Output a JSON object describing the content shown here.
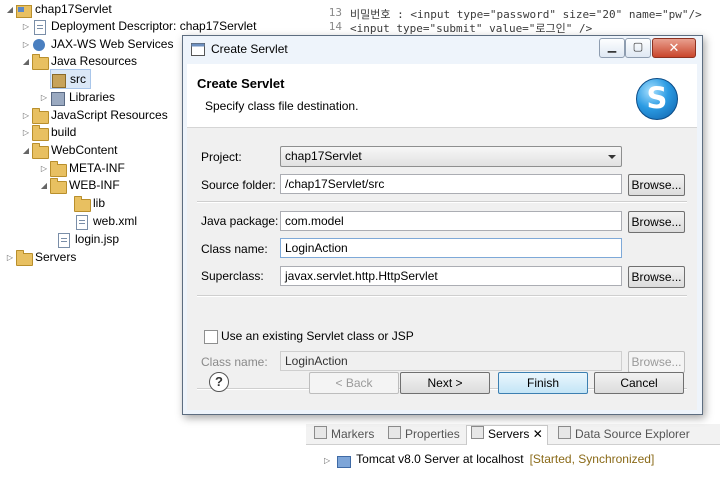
{
  "tree": {
    "items": [
      {
        "label": "chap17Servlet"
      },
      {
        "label": "Deployment Descriptor: chap17Servlet"
      },
      {
        "label": "JAX-WS Web Services"
      },
      {
        "label": "Java Resources"
      },
      {
        "label": "src"
      },
      {
        "label": "Libraries"
      },
      {
        "label": "JavaScript Resources"
      },
      {
        "label": "build"
      },
      {
        "label": "WebContent"
      },
      {
        "label": "META-INF"
      },
      {
        "label": "WEB-INF"
      },
      {
        "label": "lib"
      },
      {
        "label": "web.xml"
      },
      {
        "label": "login.jsp"
      },
      {
        "label": "Servers"
      }
    ]
  },
  "editor": {
    "lines": [
      {
        "num": "13",
        "text": "비밀번호 : <input type=\"password\" size=\"20\" name=\"pw\"/>"
      },
      {
        "num": "14",
        "text": "<input type=\"submit\" value=\"로그인\" />"
      }
    ]
  },
  "views": {
    "tabs": [
      "Markers",
      "Properties",
      "Servers",
      "Data Source Explorer"
    ],
    "server": {
      "name": "Tomcat v8.0 Server at localhost",
      "status": "[Started, Synchronized]"
    }
  },
  "dialog": {
    "window_title": "Create Servlet",
    "header_title": "Create Servlet",
    "header_desc": "Specify class file destination.",
    "logo_letter": "S",
    "project_label": "Project:",
    "project_value": "chap17Servlet",
    "source_folder_label": "Source folder:",
    "source_folder_value": "/chap17Servlet/src",
    "java_package_label": "Java package:",
    "java_package_value": "com.model",
    "class_name_label": "Class name:",
    "class_name_value": "LoginAction",
    "superclass_label": "Superclass:",
    "superclass_value": "javax.servlet.http.HttpServlet",
    "use_existing_label": "Use an existing Servlet class or JSP",
    "existing_class_label": "Class name:",
    "existing_class_value": "LoginAction",
    "browse_label": "Browse...",
    "help_symbol": "?",
    "back_label": "< Back",
    "next_label": "Next >",
    "finish_label": "Finish",
    "cancel_label": "Cancel"
  }
}
